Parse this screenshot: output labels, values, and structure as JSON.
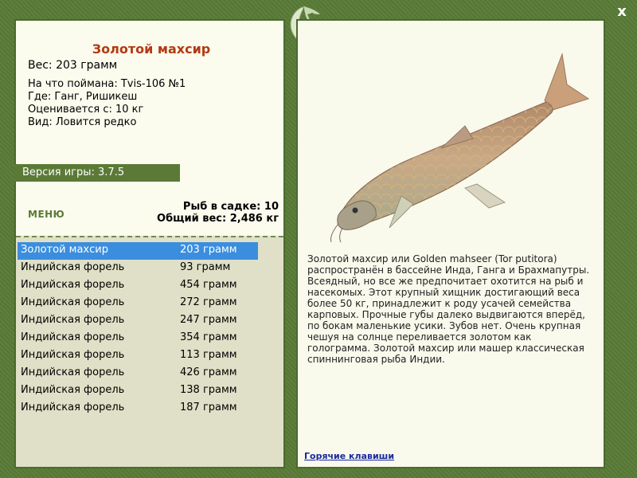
{
  "window": {
    "close_label": "x"
  },
  "fish": {
    "title": "Золотой махсир",
    "weight": "Вес: 203 грамм",
    "info": [
      "На что поймана: Tvis-106 №1",
      "Где: Ганг, Ришикеш",
      "Оценивается с: 10 кг",
      "Вид: Ловится редко"
    ],
    "description": "Золотой махсир или Golden mahseer (Tor putitora) распространён в бассейне Инда, Ганга и Брахмапутры. Всеядный, но все же предпочитает охотится на рыб и насекомых. Этот крупный хищник достигающий веса более 50 кг, принадлежит к роду усачей семейства карповых. Прочные губы далеко выдвигаются вперёд, по бокам маленькие усики. Зубов нет. Очень крупная чешуя на солнце переливается золотом как голограмма. Золотой махсир или машер классическая спиннинговая рыба Индии."
  },
  "version": "Версия игры: 3.7.5",
  "menu_label": "МЕНЮ",
  "sack": {
    "count": "Рыб в садке: 10",
    "total_weight": "Общий вес: 2,486 кг"
  },
  "catch_list": [
    {
      "name": "Золотой махсир",
      "weight": "203 грамм",
      "selected": true
    },
    {
      "name": "Индийская форель",
      "weight": "93 грамм"
    },
    {
      "name": "Индийская форель",
      "weight": "454 грамм"
    },
    {
      "name": "Индийская форель",
      "weight": "272 грамм"
    },
    {
      "name": "Индийская форель",
      "weight": "247 грамм"
    },
    {
      "name": "Индийская форель",
      "weight": "354 грамм"
    },
    {
      "name": "Индийская форель",
      "weight": "113 грамм"
    },
    {
      "name": "Индийская форель",
      "weight": "426 грамм"
    },
    {
      "name": "Индийская форель",
      "weight": "138 грамм"
    },
    {
      "name": "Индийская форель",
      "weight": "187 грамм"
    }
  ],
  "hotkeys_label": "Горячие клавиши",
  "colors": {
    "frame": "#587a36",
    "title": "#b23a12",
    "selected_row": "#3b8ede",
    "link": "#1a2aa0"
  }
}
